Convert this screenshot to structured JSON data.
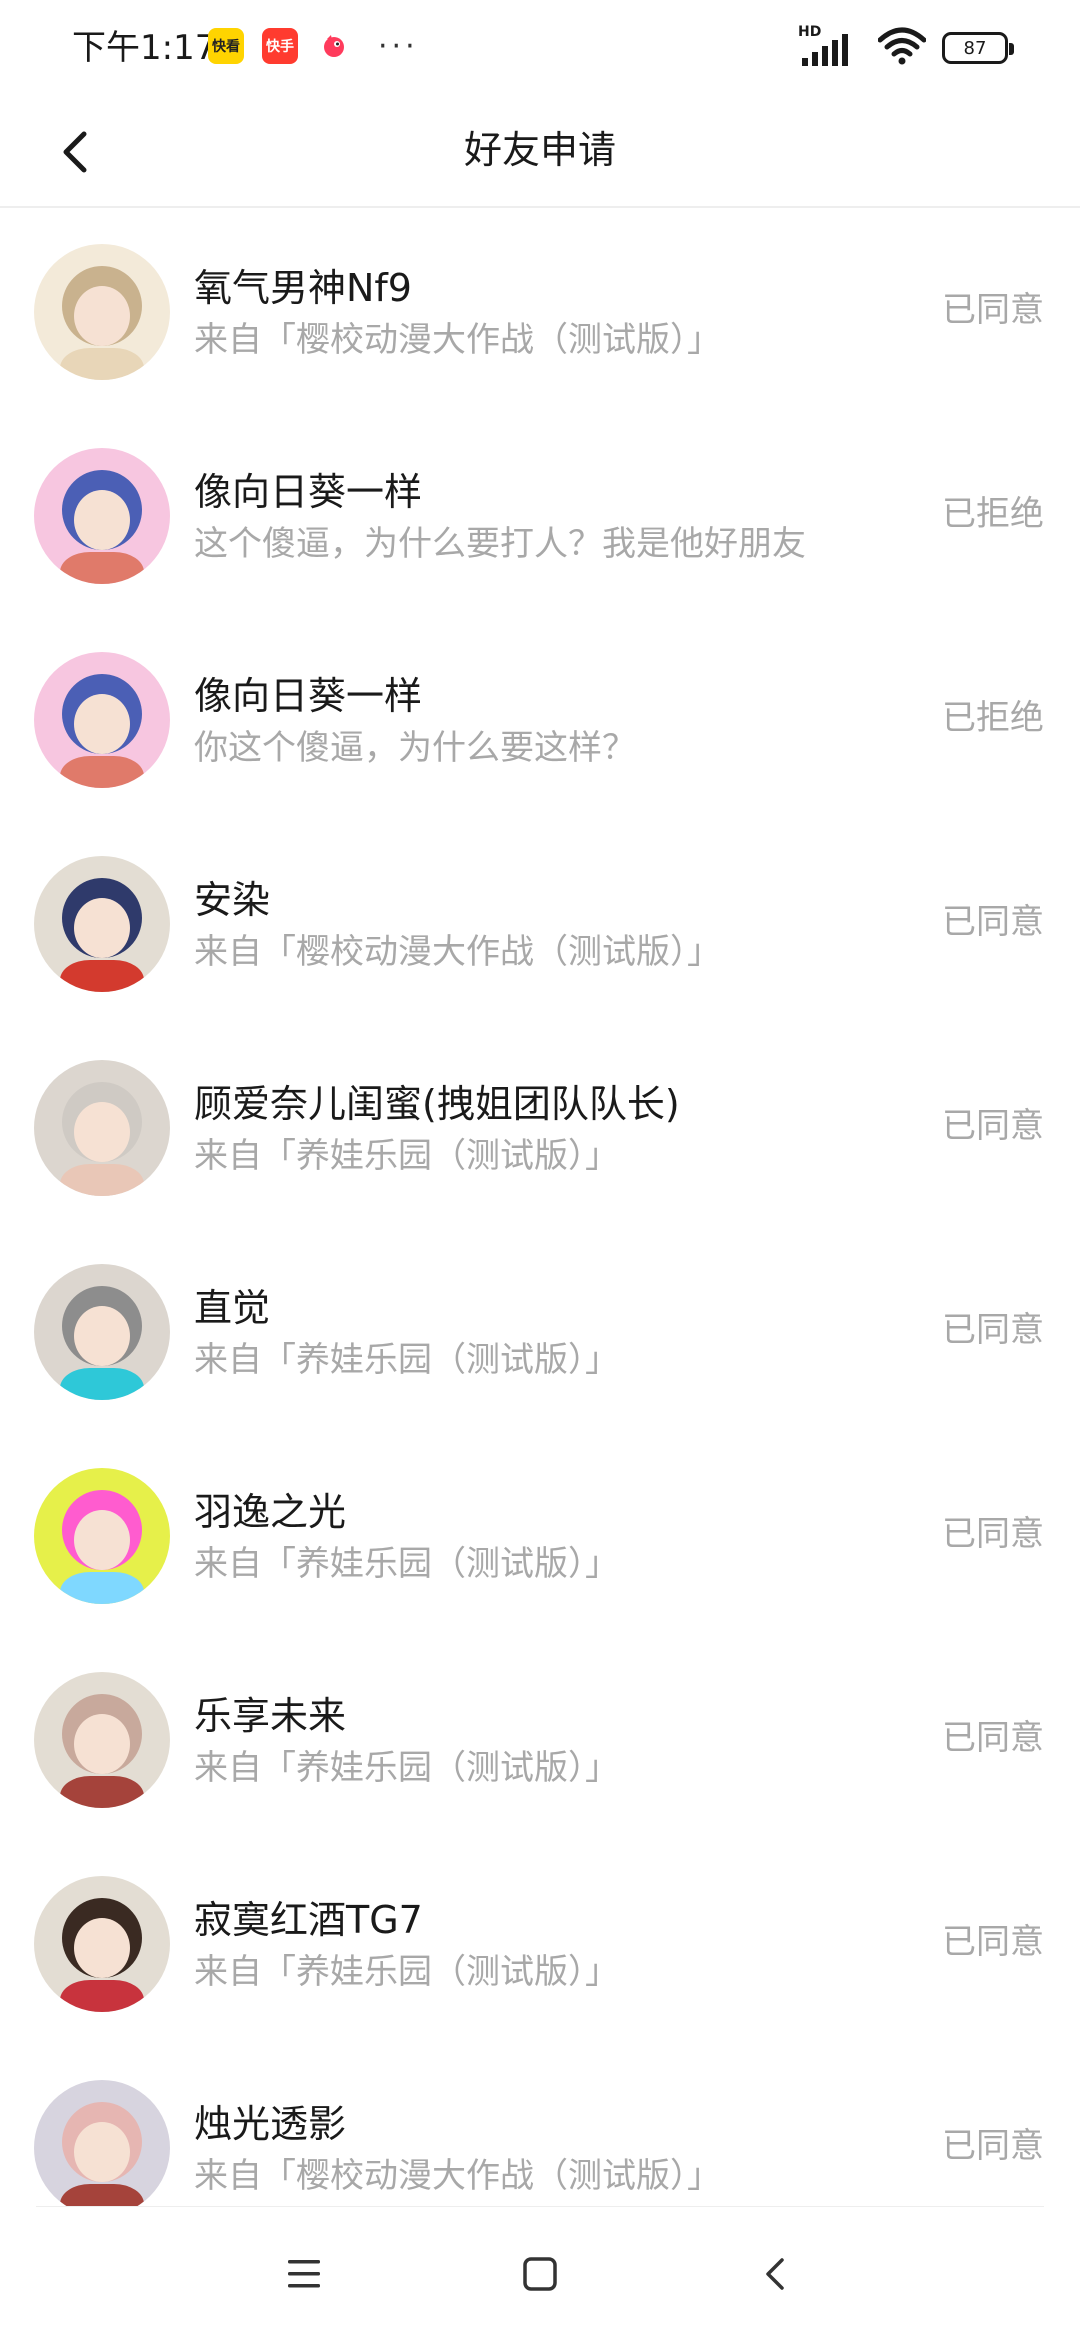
{
  "status_bar": {
    "time": "下午1:17",
    "apps": [
      "快看",
      "快手",
      "bird-icon"
    ],
    "more": "···",
    "network": "HD",
    "battery": "87"
  },
  "header": {
    "title": "好友申请"
  },
  "requests": [
    {
      "name": "氧气男神Nf9",
      "message": "来自「樱校动漫大作战（测试版）」",
      "status": "已同意",
      "avatar_colors": [
        "#f3ead9",
        "#c9b28e",
        "#e8d6b8"
      ]
    },
    {
      "name": "像向日葵一样",
      "message": "这个傻逼，为什么要打人？我是他好朋友",
      "status": "已拒绝",
      "avatar_colors": [
        "#f7c6e0",
        "#4b5fb5",
        "#e07a6a"
      ]
    },
    {
      "name": "像向日葵一样",
      "message": "你这个傻逼，为什么要这样？",
      "status": "已拒绝",
      "avatar_colors": [
        "#f7c6e0",
        "#4b5fb5",
        "#e07a6a"
      ]
    },
    {
      "name": "安染",
      "message": "来自「樱校动漫大作战（测试版）」",
      "status": "已同意",
      "avatar_colors": [
        "#e3ddd3",
        "#2f3a6b",
        "#d33a2e"
      ]
    },
    {
      "name": "顾爱奈儿闺蜜(拽姐团队队长)",
      "message": "来自「养娃乐园（测试版）」",
      "status": "已同意",
      "avatar_colors": [
        "#dcd6cf",
        "#cfcac4",
        "#e9c7b7"
      ]
    },
    {
      "name": "直觉",
      "message": "来自「养娃乐园（测试版）」",
      "status": "已同意",
      "avatar_colors": [
        "#dcd6cf",
        "#8d8d8d",
        "#2ec8d8"
      ]
    },
    {
      "name": "羽逸之光",
      "message": "来自「养娃乐园（测试版）」",
      "status": "已同意",
      "avatar_colors": [
        "#e6f04a",
        "#ff5ccf",
        "#7fd8ff"
      ]
    },
    {
      "name": "乐享未来",
      "message": "来自「养娃乐园（测试版）」",
      "status": "已同意",
      "avatar_colors": [
        "#e3ddd3",
        "#c8a99c",
        "#a5433b"
      ]
    },
    {
      "name": "寂寞红酒TG7",
      "message": "来自「养娃乐园（测试版）」",
      "status": "已同意",
      "avatar_colors": [
        "#e3ddd3",
        "#3a2a22",
        "#c8333d"
      ]
    },
    {
      "name": "烛光透影",
      "message": "来自「樱校动漫大作战（测试版）」",
      "status": "已同意",
      "avatar_colors": [
        "#d7d4df",
        "#e6b6b2",
        "#a5433b"
      ]
    }
  ],
  "nav": {
    "buttons": [
      "menu-icon",
      "home-icon",
      "back-icon"
    ]
  }
}
